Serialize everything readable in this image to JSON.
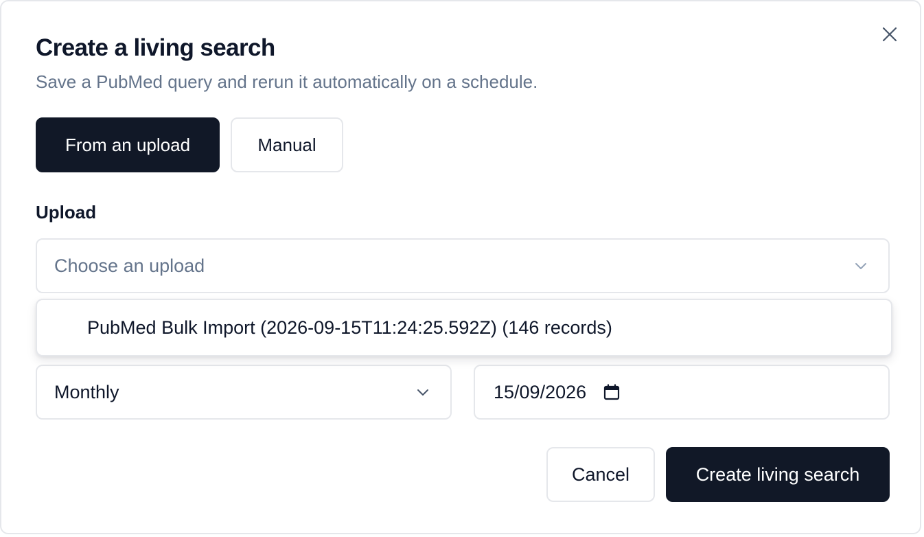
{
  "dialog": {
    "title": "Create a living search",
    "subtitle": "Save a PubMed query and rerun it automatically on a schedule.",
    "close_icon": "close-icon"
  },
  "tabs": [
    {
      "label": "From an upload",
      "active": true
    },
    {
      "label": "Manual",
      "active": false
    }
  ],
  "upload": {
    "label": "Upload",
    "placeholder": "Choose an upload",
    "options": [
      {
        "label": "PubMed Bulk Import (2026-09-15T11:24:25.592Z) (146 records)"
      }
    ]
  },
  "schedule": {
    "frequency": "Monthly",
    "start_date": "15/09/2026",
    "calendar_icon": "calendar-icon"
  },
  "actions": {
    "cancel_label": "Cancel",
    "create_label": "Create living search"
  },
  "colors": {
    "primary": "#111827",
    "muted_text": "#64748b",
    "border": "#e5e7eb"
  }
}
